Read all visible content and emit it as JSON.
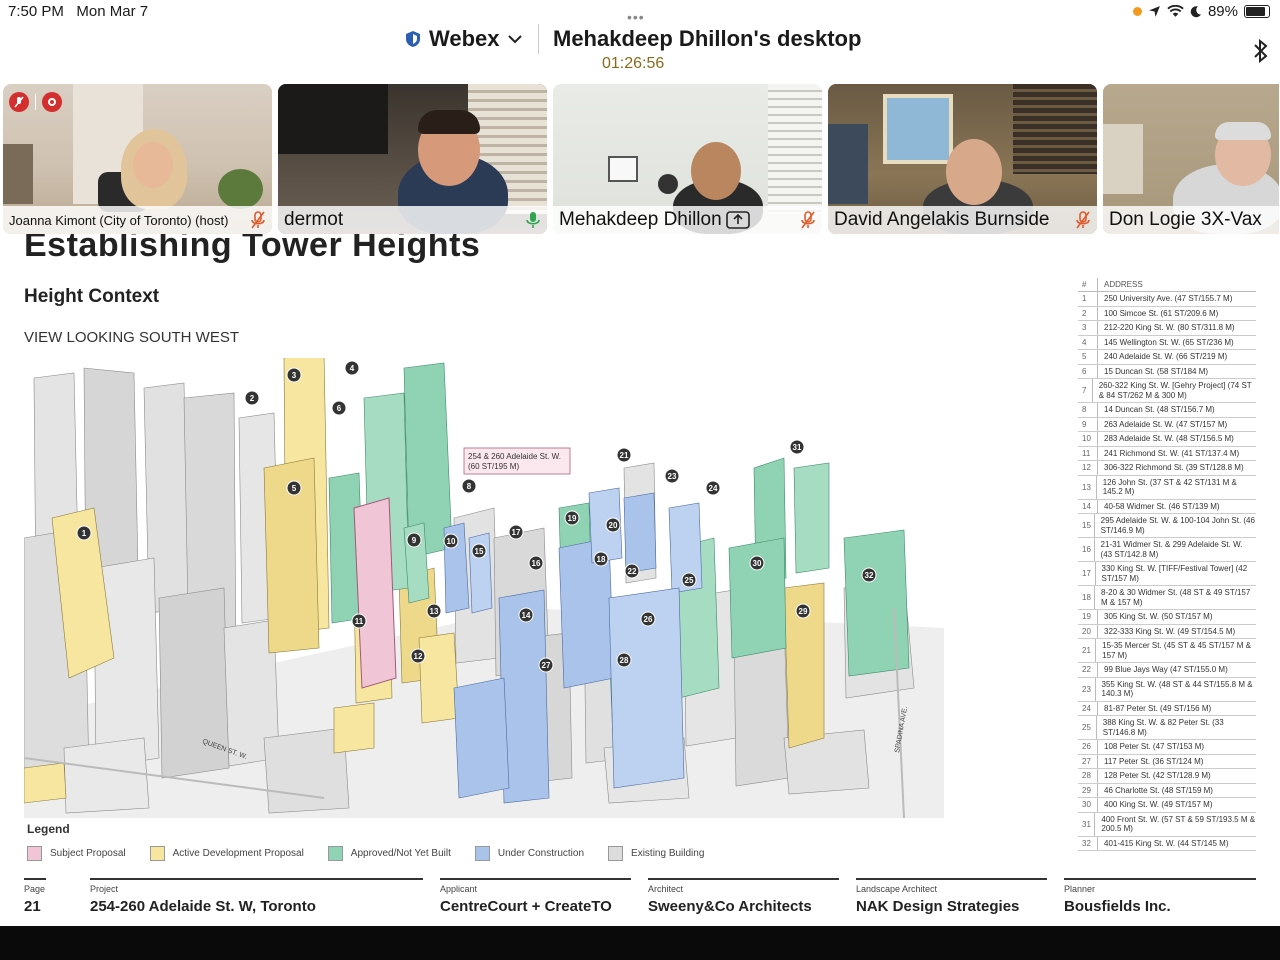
{
  "status_bar": {
    "time": "7:50 PM",
    "date": "Mon Mar 7",
    "battery": "89%",
    "battery_level": 0.89
  },
  "header": {
    "app_name": "Webex",
    "share_title": "Mehakdeep Dhillon's desktop",
    "timer": "01:26:56"
  },
  "participants": [
    {
      "name": "Joanna Kimont (City of Toronto) (host)",
      "muted": true
    },
    {
      "name": "dermot",
      "muted": false
    },
    {
      "name": "Mehakdeep Dhillon",
      "muted": true,
      "presenting": true
    },
    {
      "name": "David Angelakis Burnside",
      "muted": true
    },
    {
      "name": "Don Logie 3X-Vax"
    }
  ],
  "slide": {
    "title": "Establishing Tower Heights",
    "subtitle": "Height Context",
    "view_label": "VIEW LOOKING SOUTH WEST",
    "callout": "254 & 260 Adelaide St. W.\n(60 ST/195 M)",
    "street_queen": "QUEEN ST. W.",
    "street_spadina": "SPADINA AVE.",
    "legend_title": "Legend",
    "legend": [
      {
        "label": "Subject Proposal",
        "color": "#f0c6d6"
      },
      {
        "label": "Active Development Proposal",
        "color": "#f6e6a0"
      },
      {
        "label": "Approved/Not Yet Built",
        "color": "#8fd3b4"
      },
      {
        "label": "Under Construction",
        "color": "#a9c3ea"
      },
      {
        "label": "Existing Building",
        "color": "#dcdcdc"
      }
    ],
    "address_table": {
      "col_num": "#",
      "col_address": "ADDRESS",
      "rows": [
        {
          "n": "1",
          "a": "250 University Ave. (47 ST/155.7 M)"
        },
        {
          "n": "2",
          "a": "100 Simcoe St. (61 ST/209.6 M)"
        },
        {
          "n": "3",
          "a": "212-220 King St. W. (80 ST/311.8 M)"
        },
        {
          "n": "4",
          "a": "145 Wellington St. W. (65 ST/236 M)"
        },
        {
          "n": "5",
          "a": "240 Adelaide St. W. (66 ST/219 M)"
        },
        {
          "n": "6",
          "a": "15 Duncan St. (58 ST/184 M)"
        },
        {
          "n": "7",
          "a": "260-322 King St. W. [Gehry Project] (74 ST & 84 ST/262 M & 300 M)"
        },
        {
          "n": "8",
          "a": "14 Duncan St. (48 ST/156.7 M)"
        },
        {
          "n": "9",
          "a": "263 Adelaide St. W. (47 ST/157 M)"
        },
        {
          "n": "10",
          "a": "283 Adelaide St. W. (48 ST/156.5 M)"
        },
        {
          "n": "11",
          "a": "241 Richmond St. W. (41 ST/137.4 M)"
        },
        {
          "n": "12",
          "a": "306-322 Richmond St. (39 ST/128.8 M)"
        },
        {
          "n": "13",
          "a": "126 John St. (37 ST & 42 ST/131 M & 145.2 M)"
        },
        {
          "n": "14",
          "a": "40-58 Widmer St. (46 ST/139 M)"
        },
        {
          "n": "15",
          "a": "295 Adelaide St. W. & 100-104 John St. (46 ST/146.9 M)"
        },
        {
          "n": "16",
          "a": "21-31 Widmer St. & 299 Adelaide St. W. (43 ST/142.8 M)"
        },
        {
          "n": "17",
          "a": "330 King St. W. [TIFF/Festival Tower] (42 ST/157 M)"
        },
        {
          "n": "18",
          "a": "8-20 & 30 Widmer St. (48 ST & 49 ST/157 M & 157 M)"
        },
        {
          "n": "19",
          "a": "305 King St. W. (50 ST/157 M)"
        },
        {
          "n": "20",
          "a": "322-333 King St. W. (49 ST/154.5 M)"
        },
        {
          "n": "21",
          "a": "15-35 Mercer St. (45 ST & 45 ST/157 M & 157 M)"
        },
        {
          "n": "22",
          "a": "99 Blue Jays Way (47 ST/155.0 M)"
        },
        {
          "n": "23",
          "a": "355 King St. W. (48 ST & 44 ST/155.8 M & 140.3 M)"
        },
        {
          "n": "24",
          "a": "81-87 Peter St. (49 ST/156 M)"
        },
        {
          "n": "25",
          "a": "388 King St. W. & 82 Peter St. (33 ST/146.8 M)"
        },
        {
          "n": "26",
          "a": "108 Peter St. (47 ST/153 M)"
        },
        {
          "n": "27",
          "a": "117 Peter St. (36 ST/124 M)"
        },
        {
          "n": "28",
          "a": "128 Peter St. (42 ST/128.9 M)"
        },
        {
          "n": "29",
          "a": "46 Charlotte St. (48 ST/159 M)"
        },
        {
          "n": "30",
          "a": "400 King St. W. (49 ST/157 M)"
        },
        {
          "n": "31",
          "a": "400 Front St. W. (57 ST & 59 ST/193.5 M & 200.5 M)"
        },
        {
          "n": "32",
          "a": "401-415 King St. W. (44 ST/145 M)"
        }
      ]
    },
    "footer": {
      "page_label": "Page",
      "page_value": "21",
      "project_label": "Project",
      "project_value": "254-260 Adelaide St. W, Toronto",
      "applicant_label": "Applicant",
      "applicant_value": "CentreCourt + CreateTO",
      "architect_label": "Architect",
      "architect_value": "Sweeny&Co Architects",
      "landscape_label": "Landscape Architect",
      "landscape_value": "NAK Design Strategies",
      "planner_label": "Planner",
      "planner_value": "Bousfields Inc."
    }
  }
}
